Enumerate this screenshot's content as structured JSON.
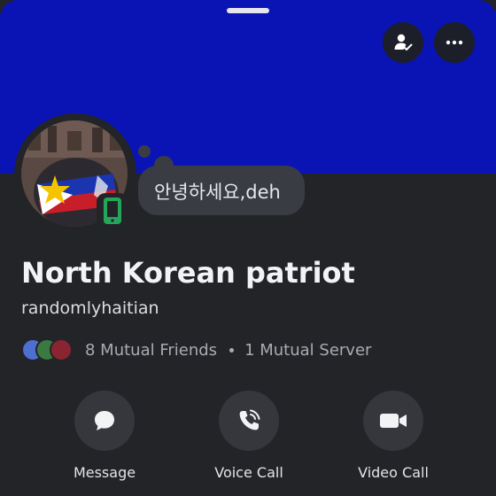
{
  "profile": {
    "display_name": "North Korean patriot",
    "username": "randomlyhaitian",
    "custom_status": "안녕하세요,deh",
    "online_status": "mobile",
    "banner_color": "#0a14b4"
  },
  "header": {
    "icons": [
      "drag-handle",
      "add-friend-icon",
      "more-icon"
    ]
  },
  "mutuals": {
    "friends_label": "8 Mutual Friends",
    "servers_label": "1 Mutual Server"
  },
  "actions": [
    {
      "label": "Message",
      "icon": "chat-bubble-icon"
    },
    {
      "label": "Voice Call",
      "icon": "phone-icon"
    },
    {
      "label": "Video Call",
      "icon": "video-camera-icon"
    }
  ],
  "colors": {
    "background": "#232428",
    "bubble": "#3a3c43",
    "status_green": "#23a55a"
  }
}
